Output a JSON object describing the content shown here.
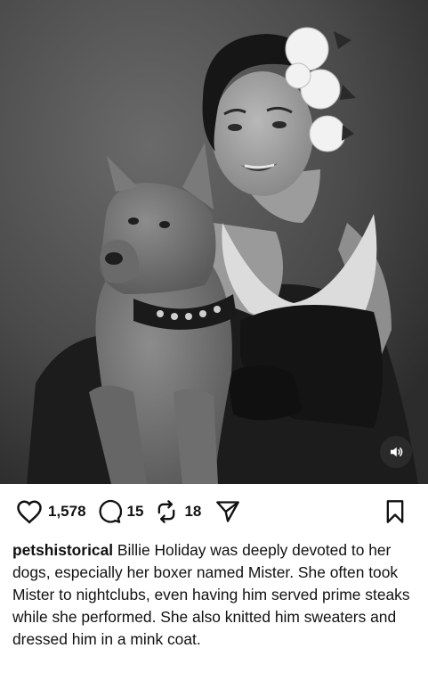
{
  "post": {
    "image_alt": "Black and white portrait of Billie Holiday with white gardenias in her hair, holding her boxer dog Mister wearing a studded collar",
    "audio_icon": "speaker-icon"
  },
  "actions": {
    "likes": "1,578",
    "comments": "15",
    "reposts": "18",
    "like_icon": "heart-icon",
    "comment_icon": "comment-bubble-icon",
    "repost_icon": "repost-icon",
    "share_icon": "send-icon",
    "save_icon": "bookmark-icon"
  },
  "caption": {
    "username": "petshistorical",
    "text": "Billie Holiday was deeply devoted to her dogs, especially her boxer named Mister. She often took Mister to nightclubs, even having him served prime steaks while she performed. She also knitted him sweaters and dressed him in a mink coat."
  }
}
